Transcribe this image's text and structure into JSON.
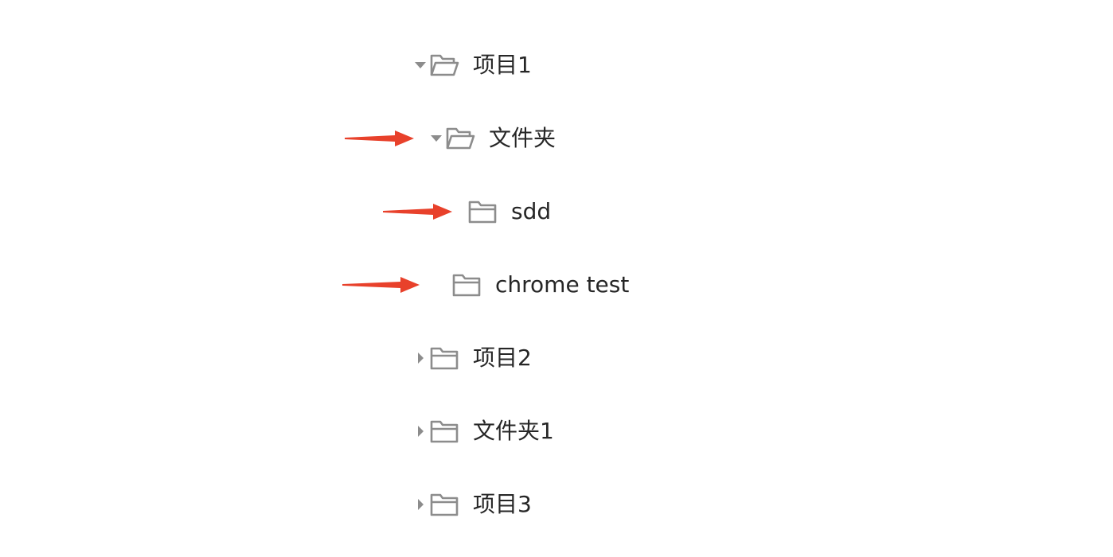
{
  "tree": {
    "nodes": [
      {
        "label": "项目1",
        "icon": "folder-open-icon",
        "caret": "caret-down-icon",
        "expanded": true
      },
      {
        "label": "文件夹",
        "icon": "folder-open-icon",
        "caret": "caret-down-icon",
        "expanded": true
      },
      {
        "label": "sdd",
        "icon": "folder-icon",
        "caret": "",
        "expanded": false
      },
      {
        "label": "chrome test",
        "icon": "folder-icon",
        "caret": "",
        "expanded": false
      },
      {
        "label": "项目2",
        "icon": "folder-icon",
        "caret": "caret-right-icon",
        "expanded": false
      },
      {
        "label": "文件夹1",
        "icon": "folder-icon",
        "caret": "caret-right-icon",
        "expanded": false
      },
      {
        "label": "项目3",
        "icon": "folder-icon",
        "caret": "caret-right-icon",
        "expanded": false
      }
    ]
  },
  "annotations": {
    "arrow_color": "#e8412b",
    "arrow_icon": "red-arrow-icon"
  },
  "colors": {
    "icon": "#8c8c8c",
    "text": "#262626",
    "background": "#ffffff"
  }
}
